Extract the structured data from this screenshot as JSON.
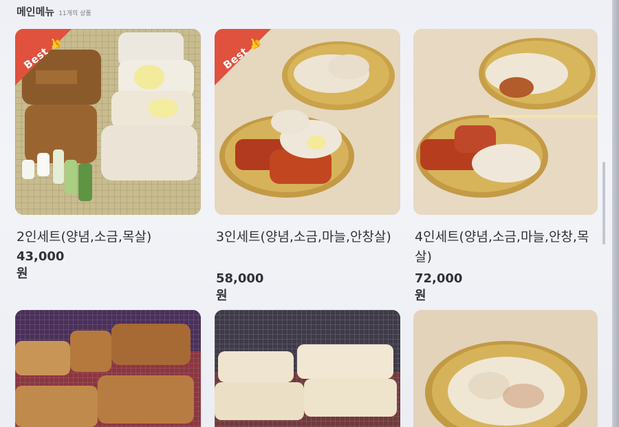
{
  "header": {
    "title": "메인메뉴",
    "count": "11개의 상품"
  },
  "badge": {
    "best_label": "Best"
  },
  "items": [
    {
      "name": "2인세트(양념,소금,목살)",
      "price": "43,000 원",
      "best": true
    },
    {
      "name": "3인세트(양념,소금,마늘,안창살)",
      "price": "58,000 원",
      "best": true
    },
    {
      "name": "4인세트(양념,소금,마늘,안창,목살)",
      "price": "72,000 원",
      "best": false
    }
  ],
  "colors": {
    "best_ribbon": "#d94a3a",
    "text": "#2f3238"
  }
}
